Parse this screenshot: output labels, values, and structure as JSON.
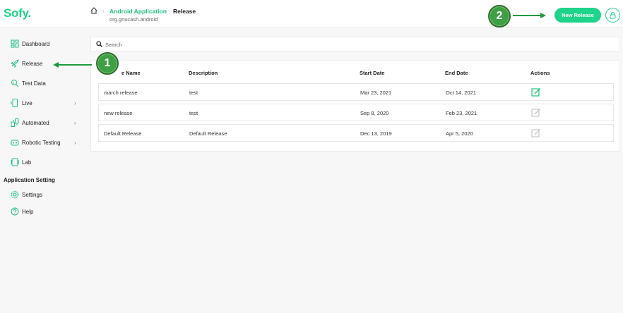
{
  "app": {
    "logo": "Sofy",
    "logo_dot": "."
  },
  "breadcrumb": {
    "sep": "›",
    "app": "Android Application",
    "current": "Release",
    "package": "org.gnucash.android"
  },
  "header": {
    "new_release_label": "New Release"
  },
  "sidebar": {
    "items": [
      {
        "label": "Dashboard",
        "icon": "dashboard-icon"
      },
      {
        "label": "Release",
        "icon": "rocket-icon"
      },
      {
        "label": "Test Data",
        "icon": "test-data-icon"
      },
      {
        "label": "Live",
        "icon": "phone-icon",
        "chevron": "›"
      },
      {
        "label": "Automated",
        "icon": "automated-icon",
        "chevron": "›"
      },
      {
        "label": "Robotic Testing",
        "icon": "robot-icon",
        "chevron": "›"
      },
      {
        "label": "Lab",
        "icon": "lab-icon"
      }
    ],
    "section_heading": "Application Setting",
    "settings_items": [
      {
        "label": "Settings",
        "icon": "gear-icon"
      },
      {
        "label": "Help",
        "icon": "help-icon"
      }
    ]
  },
  "search": {
    "placeholder": "Search",
    "value": ""
  },
  "table": {
    "headers": [
      "e Name",
      "Description",
      "Start Date",
      "End Date",
      "Actions"
    ],
    "rows": [
      {
        "name": "march release",
        "description": "test",
        "start": "Mar 23, 2021",
        "end": "Oct 14, 2021",
        "edit_active": true
      },
      {
        "name": "new release",
        "description": "test",
        "start": "Sep 8, 2020",
        "end": "Feb 23, 2021",
        "edit_active": false
      },
      {
        "name": "Default Release",
        "description": "Default Release",
        "start": "Dec 13, 2019",
        "end": "Apr 5, 2020",
        "edit_active": false
      }
    ]
  },
  "annotations": {
    "callout_1": "1",
    "callout_2": "2"
  },
  "colors": {
    "brand": "#1ed38a",
    "callout_green": "#3da043",
    "arrow_green": "#1f9a3f",
    "edit_active": "#1ec07d",
    "edit_inactive": "#c8c8c8"
  }
}
